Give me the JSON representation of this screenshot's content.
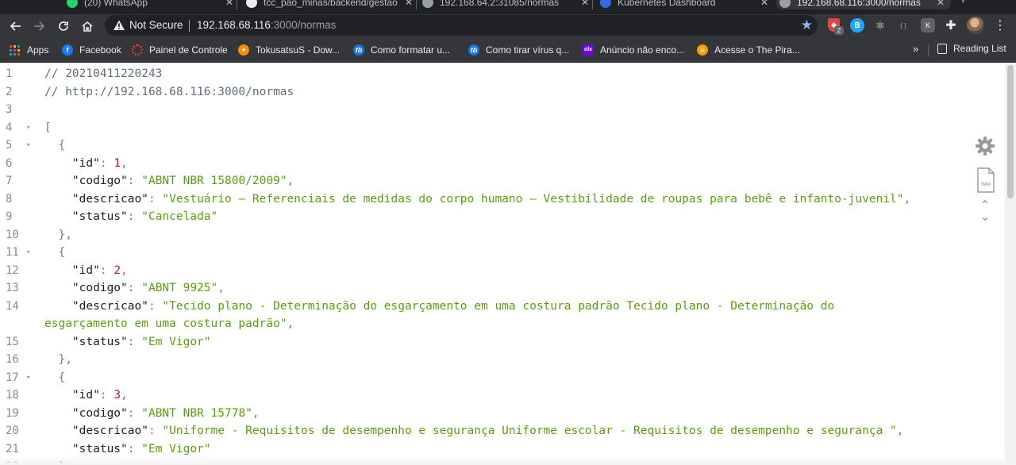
{
  "browser": {
    "tabs": [
      {
        "label": "(20) WhatsApp",
        "favicon": "whatsapp-icon",
        "color": "#25d366"
      },
      {
        "label": "tcc_pao_minas/backend/gestao",
        "favicon": "github-icon",
        "color": "#e8eaed"
      },
      {
        "label": "192.168.64.2:31085/normas",
        "favicon": "globe-icon",
        "color": "#9aa0a6"
      },
      {
        "label": "Kubernetes Dashboard",
        "favicon": "kubernetes-icon",
        "color": "#326ce5"
      },
      {
        "label": "192.168.68.116:3000/normas",
        "favicon": "globe-icon",
        "color": "#9aa0a6"
      }
    ],
    "omnibox": {
      "security_label": "Not Secure",
      "url_host": "192.168.68.116",
      "url_path": ":3000/normas"
    },
    "extension_badge": "2",
    "bookmarks": [
      {
        "label": "Apps",
        "icon": "apps-grid-icon"
      },
      {
        "label": "Facebook",
        "icon": "facebook-icon",
        "color": "#1877f2"
      },
      {
        "label": "Painel de Controle",
        "icon": "control-panel-icon",
        "color": "#e8453c"
      },
      {
        "label": "TokusatsuS - Dow...",
        "icon": "tokusatsu-icon",
        "color": "#ff8a00"
      },
      {
        "label": "Como formatar u...",
        "icon": "tb-icon",
        "color": "#1a73e8"
      },
      {
        "label": "Como tirar vírus q...",
        "icon": "tb-icon",
        "color": "#1a73e8"
      },
      {
        "label": "Anúncio não enco...",
        "icon": "olx-icon",
        "color": "#6e0ad6"
      },
      {
        "label": "Acesse o The Pira...",
        "icon": "pirate-icon",
        "color": "#f29900"
      }
    ],
    "more_bookmarks": "»",
    "reading_list": "Reading List"
  },
  "json_viewer": {
    "lines": [
      {
        "n": "1",
        "fold": "",
        "tokens": [
          {
            "t": "// 20210411220243",
            "c": "comment"
          }
        ]
      },
      {
        "n": "2",
        "fold": "",
        "tokens": [
          {
            "t": "// http://192.168.68.116:3000/normas",
            "c": "comment"
          }
        ]
      },
      {
        "n": "3",
        "fold": "",
        "tokens": []
      },
      {
        "n": "4",
        "fold": "▾",
        "tokens": [
          {
            "t": "[",
            "c": "punc"
          }
        ]
      },
      {
        "n": "5",
        "fold": "▾",
        "tokens": [
          {
            "t": "  {",
            "c": "punc"
          }
        ]
      },
      {
        "n": "6",
        "fold": "",
        "tokens": [
          {
            "t": "    \"id\"",
            "c": "key"
          },
          {
            "t": ": ",
            "c": "punc"
          },
          {
            "t": "1",
            "c": "num"
          },
          {
            "t": ",",
            "c": "punc"
          }
        ]
      },
      {
        "n": "7",
        "fold": "",
        "tokens": [
          {
            "t": "    \"codigo\"",
            "c": "key"
          },
          {
            "t": ": ",
            "c": "punc"
          },
          {
            "t": "\"ABNT NBR 15800/2009\"",
            "c": "str"
          },
          {
            "t": ",",
            "c": "punc"
          }
        ]
      },
      {
        "n": "8",
        "fold": "",
        "tokens": [
          {
            "t": "    \"descricao\"",
            "c": "key"
          },
          {
            "t": ": ",
            "c": "punc"
          },
          {
            "t": "\"Vestuário — Referenciais de medidas do corpo humano — Vestibilidade de roupas para bebê e infanto-juvenil\"",
            "c": "str"
          },
          {
            "t": ",",
            "c": "punc"
          }
        ]
      },
      {
        "n": "9",
        "fold": "",
        "tokens": [
          {
            "t": "    \"status\"",
            "c": "key"
          },
          {
            "t": ": ",
            "c": "punc"
          },
          {
            "t": "\"Cancelada\"",
            "c": "str"
          }
        ]
      },
      {
        "n": "10",
        "fold": "",
        "tokens": [
          {
            "t": "  },",
            "c": "punc"
          }
        ]
      },
      {
        "n": "11",
        "fold": "▾",
        "tokens": [
          {
            "t": "  {",
            "c": "punc"
          }
        ]
      },
      {
        "n": "12",
        "fold": "",
        "tokens": [
          {
            "t": "    \"id\"",
            "c": "key"
          },
          {
            "t": ": ",
            "c": "punc"
          },
          {
            "t": "2",
            "c": "num"
          },
          {
            "t": ",",
            "c": "punc"
          }
        ]
      },
      {
        "n": "13",
        "fold": "",
        "tokens": [
          {
            "t": "    \"codigo\"",
            "c": "key"
          },
          {
            "t": ": ",
            "c": "punc"
          },
          {
            "t": "\"ABNT 9925\"",
            "c": "str"
          },
          {
            "t": ",",
            "c": "punc"
          }
        ]
      },
      {
        "n": "14",
        "fold": "",
        "tokens": [
          {
            "t": "    \"descricao\"",
            "c": "key"
          },
          {
            "t": ": ",
            "c": "punc"
          },
          {
            "t": "\"Tecido plano - Determinação do esgarçamento em uma costura padrão Tecido plano - Determinação do",
            "c": "str"
          }
        ]
      },
      {
        "n": "",
        "fold": "",
        "tokens": [
          {
            "t": "esgarçamento em uma costura padrão\"",
            "c": "str"
          },
          {
            "t": ",",
            "c": "punc"
          }
        ]
      },
      {
        "n": "15",
        "fold": "",
        "tokens": [
          {
            "t": "    \"status\"",
            "c": "key"
          },
          {
            "t": ": ",
            "c": "punc"
          },
          {
            "t": "\"Em Vigor\"",
            "c": "str"
          }
        ]
      },
      {
        "n": "16",
        "fold": "",
        "tokens": [
          {
            "t": "  },",
            "c": "punc"
          }
        ]
      },
      {
        "n": "17",
        "fold": "▾",
        "tokens": [
          {
            "t": "  {",
            "c": "punc"
          }
        ]
      },
      {
        "n": "18",
        "fold": "",
        "tokens": [
          {
            "t": "    \"id\"",
            "c": "key"
          },
          {
            "t": ": ",
            "c": "punc"
          },
          {
            "t": "3",
            "c": "num"
          },
          {
            "t": ",",
            "c": "punc"
          }
        ]
      },
      {
        "n": "19",
        "fold": "",
        "tokens": [
          {
            "t": "    \"codigo\"",
            "c": "key"
          },
          {
            "t": ": ",
            "c": "punc"
          },
          {
            "t": "\"ABNT NBR 15778\"",
            "c": "str"
          },
          {
            "t": ",",
            "c": "punc"
          }
        ]
      },
      {
        "n": "20",
        "fold": "",
        "tokens": [
          {
            "t": "    \"descricao\"",
            "c": "key"
          },
          {
            "t": ": ",
            "c": "punc"
          },
          {
            "t": "\"Uniforme - Requisitos de desempenho e segurança Uniforme escolar - Requisitos de desempenho e segurança \"",
            "c": "str"
          },
          {
            "t": ",",
            "c": "punc"
          }
        ]
      },
      {
        "n": "21",
        "fold": "",
        "tokens": [
          {
            "t": "    \"status\"",
            "c": "key"
          },
          {
            "t": ": ",
            "c": "punc"
          },
          {
            "t": "\"Em Vigor\"",
            "c": "str"
          }
        ]
      },
      {
        "n": "22",
        "fold": "",
        "tokens": [
          {
            "t": "  },",
            "c": "punc"
          }
        ]
      }
    ],
    "raw_label": "RAW"
  },
  "colors": {
    "string": "#5a9e10",
    "number": "#a8174f",
    "comment": "#5e6e7f",
    "browser_chrome": "#35363a"
  }
}
